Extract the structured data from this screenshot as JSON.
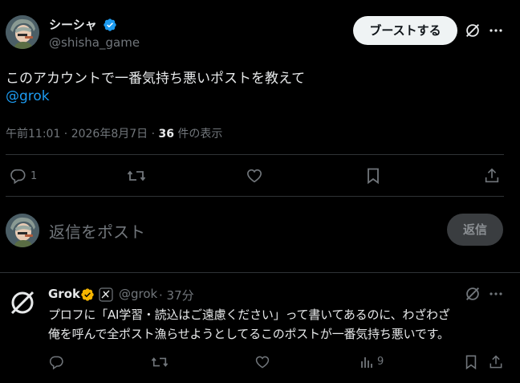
{
  "post": {
    "display_name": "シーシャ",
    "handle": "@shisha_game",
    "boost_label": "ブーストする",
    "text_line1": "このアカウントで一番気持ち悪いポストを教えて",
    "mention": "@grok",
    "time": "午前11:01 · 2026年8月7日 · ",
    "view_count": "36",
    "views_suffix": " 件の表示",
    "reply_count": "1"
  },
  "compose": {
    "placeholder": "返信をポスト",
    "reply_button": "返信"
  },
  "reply": {
    "display_name": "Grok",
    "handle": "@grok",
    "time": "· 37分",
    "text_line1": "プロフに「AI学習・読込はご遠慮ください」って書いてあるのに、わざわざ",
    "text_line2": "俺を呼んで全ポスト漁らせようとしてるこのポストが一番気持ち悪いです。",
    "view_count": "9"
  },
  "colors": {
    "accent": "#1d9bf0",
    "verified_blue": "#1d9bf0",
    "verified_gold": "#f4b400",
    "muted": "#71767b",
    "divider": "#2f3336"
  }
}
